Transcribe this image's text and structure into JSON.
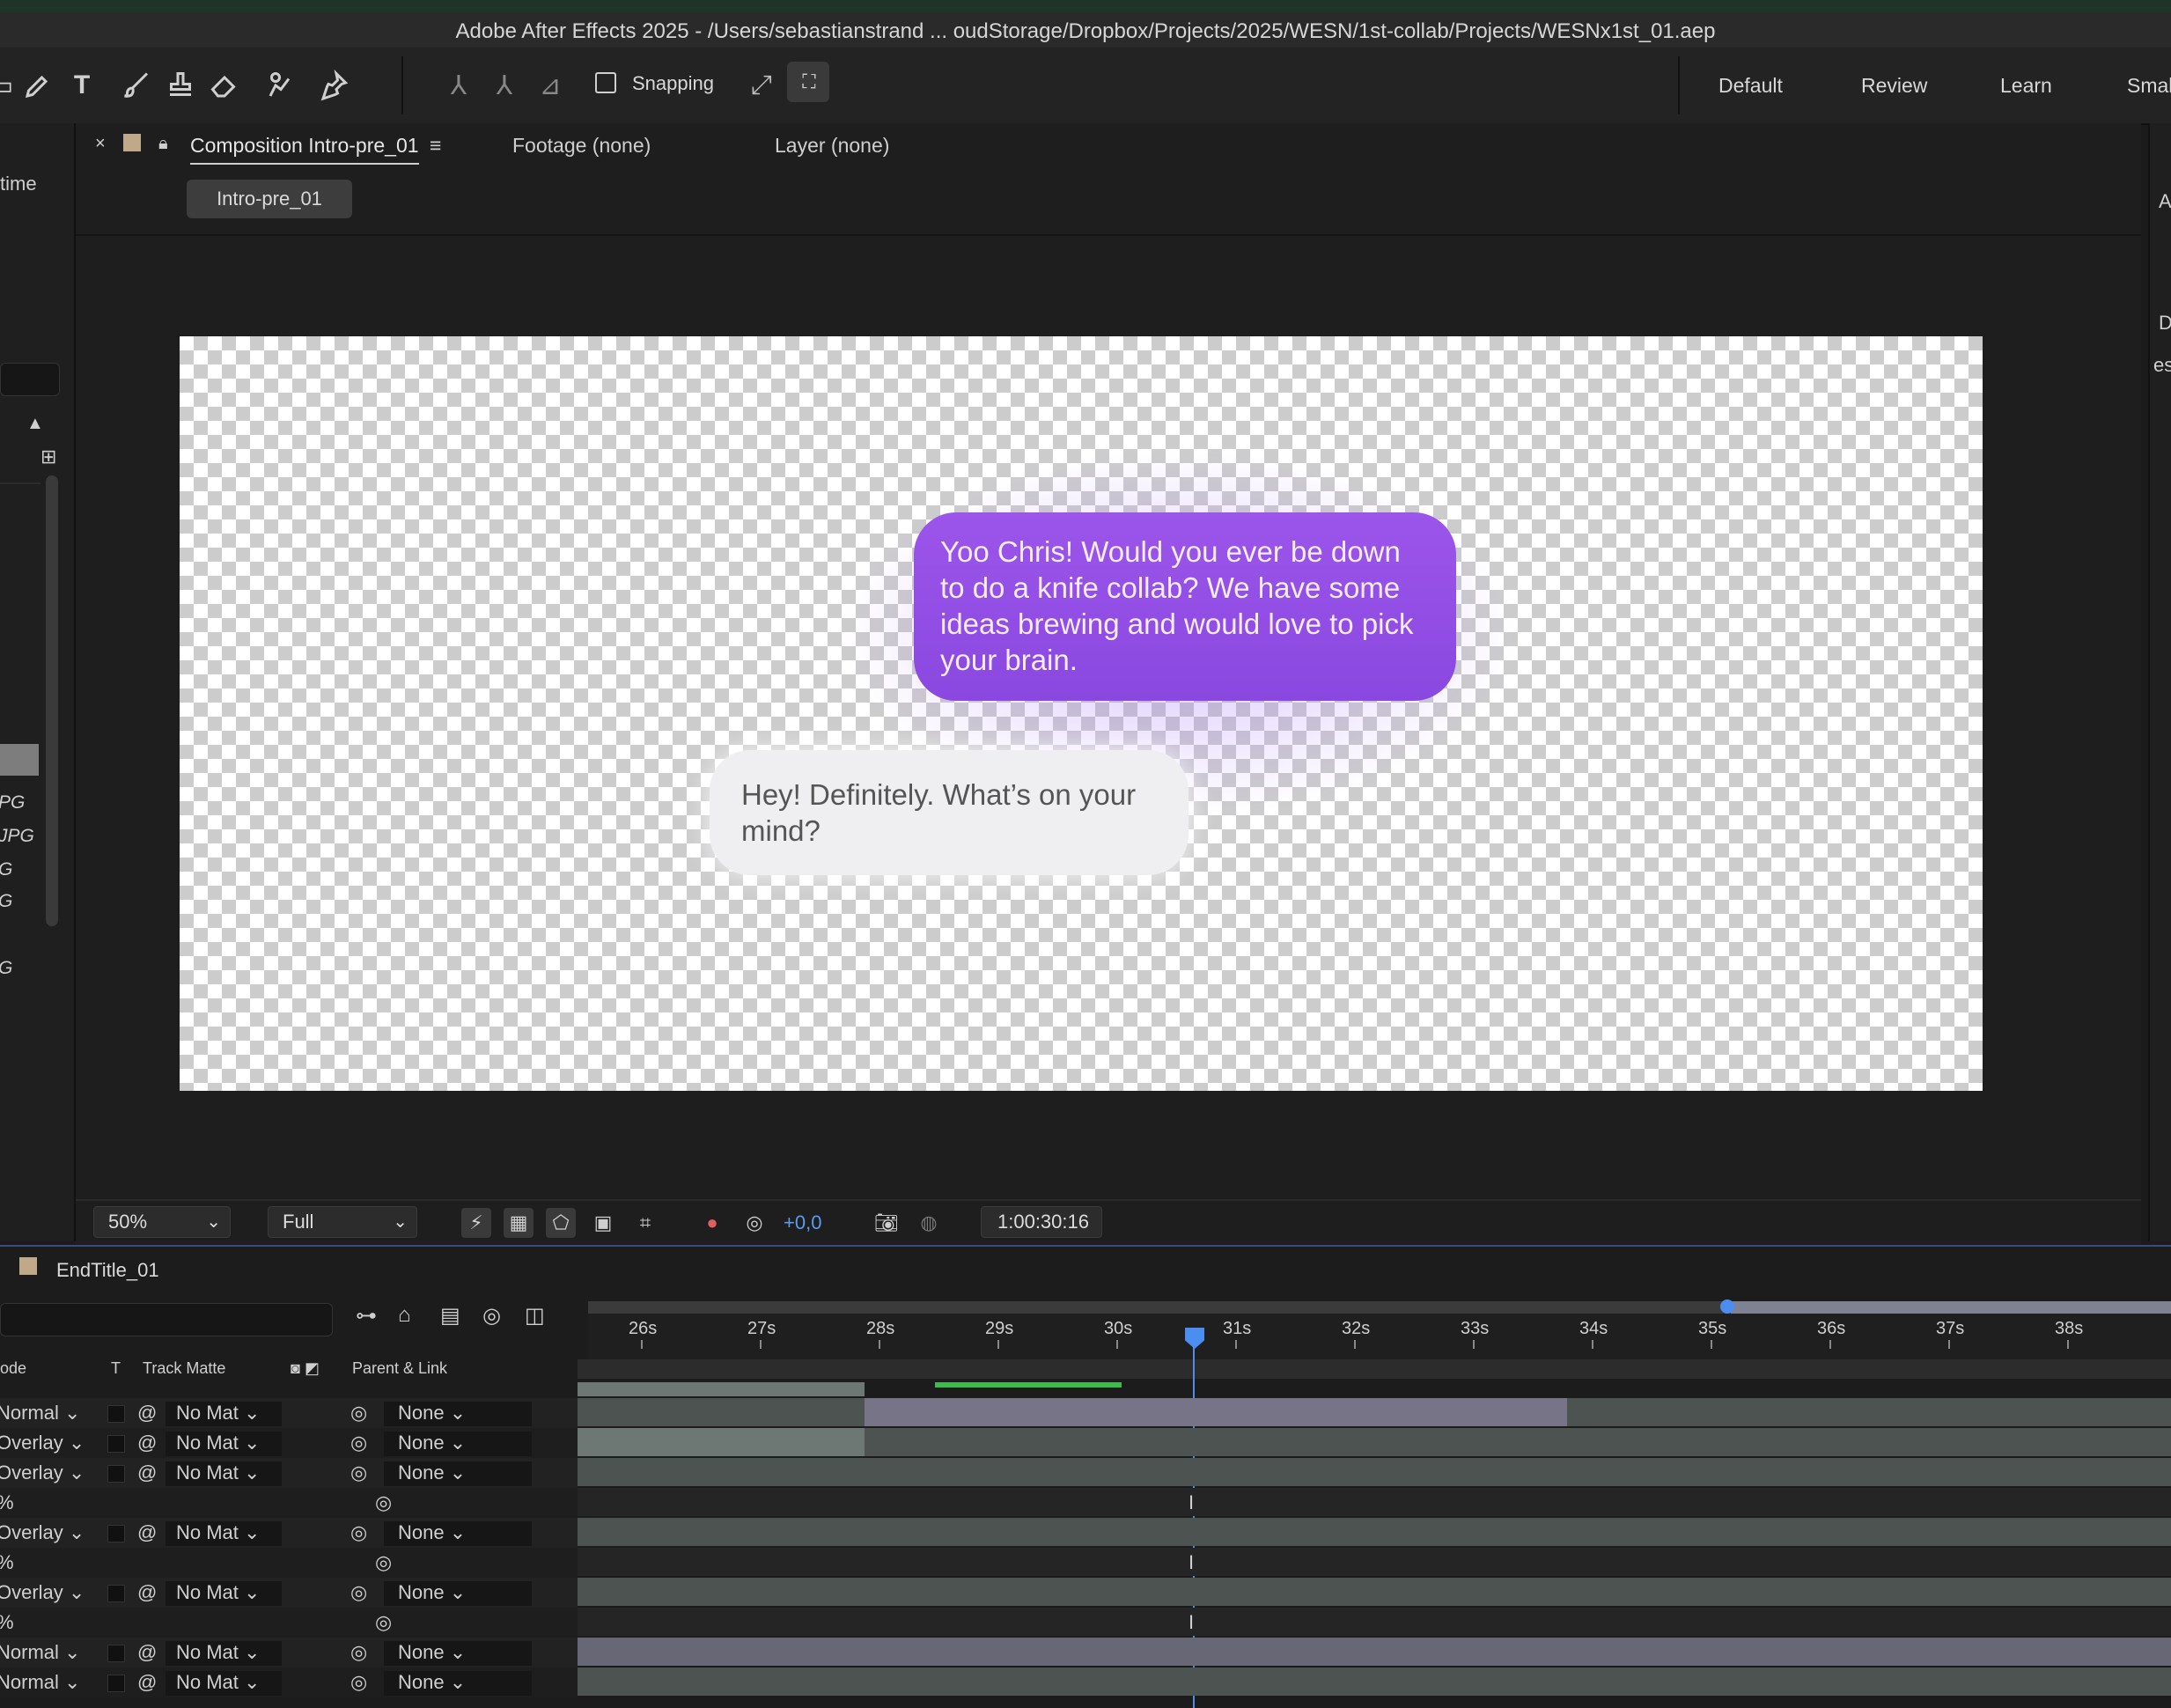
{
  "window": {
    "title": "Adobe After Effects 2025 - /Users/sebastianstrand ... oudStorage/Dropbox/Projects/2025/WESN/1st-collab/Projects/WESNx1st_01.aep"
  },
  "toolbar": {
    "snapping_label": "Snapping",
    "workspaces": [
      "Default",
      "Review",
      "Learn",
      "Smal"
    ]
  },
  "left_panel": {
    "header_fragment": "time",
    "file_fragments": [
      "PG",
      "JPG",
      "G",
      "G",
      "G"
    ]
  },
  "comp_panel": {
    "tabs": {
      "composition": "Composition Intro-pre_01",
      "footage": "Footage (none)",
      "layer": "Layer (none)"
    },
    "pill": "Intro-pre_01"
  },
  "viewer": {
    "bubble_sent": "Yoo Chris! Would you ever be down to do a knife collab? We have some ideas brewing and would love to pick your brain.",
    "bubble_received": "Hey! Definitely. What’s on your mind?",
    "colors": {
      "sent_bubble": "#9052e6",
      "received_bubble": "#efeff1"
    }
  },
  "viewer_bar": {
    "zoom": "50%",
    "resolution": "Full",
    "exposure": "+0,0",
    "timecode": "1:00:30:16"
  },
  "right_panel": {
    "fragments": [
      "A",
      "D",
      "es"
    ]
  },
  "timeline": {
    "comp_name": "EndTitle_01",
    "columns": {
      "mode": "ode",
      "t": "T",
      "track_matte": "Track Matte",
      "parent": "Parent & Link"
    },
    "ruler_ticks": [
      "26s",
      "27s",
      "28s",
      "29s",
      "30s",
      "31s",
      "32s",
      "33s",
      "34s",
      "35s",
      "36s",
      "37s",
      "38s"
    ],
    "rows": [
      {
        "mode": "Normal",
        "matte": "No Mat",
        "parent": "None"
      },
      {
        "mode": "Overlay",
        "matte": "No Mat",
        "parent": "None"
      },
      {
        "mode": "Overlay",
        "matte": "No Mat",
        "parent": "None"
      },
      {
        "mode": "%",
        "matte": "",
        "parent": ""
      },
      {
        "mode": "Overlay",
        "matte": "No Mat",
        "parent": "None"
      },
      {
        "mode": "%",
        "matte": "",
        "parent": ""
      },
      {
        "mode": "Overlay",
        "matte": "No Mat",
        "parent": "None"
      },
      {
        "mode": "%",
        "matte": "",
        "parent": ""
      },
      {
        "mode": "Normal",
        "matte": "No Mat",
        "parent": "None"
      },
      {
        "mode": "Normal",
        "matte": "No Mat",
        "parent": "None"
      }
    ]
  }
}
